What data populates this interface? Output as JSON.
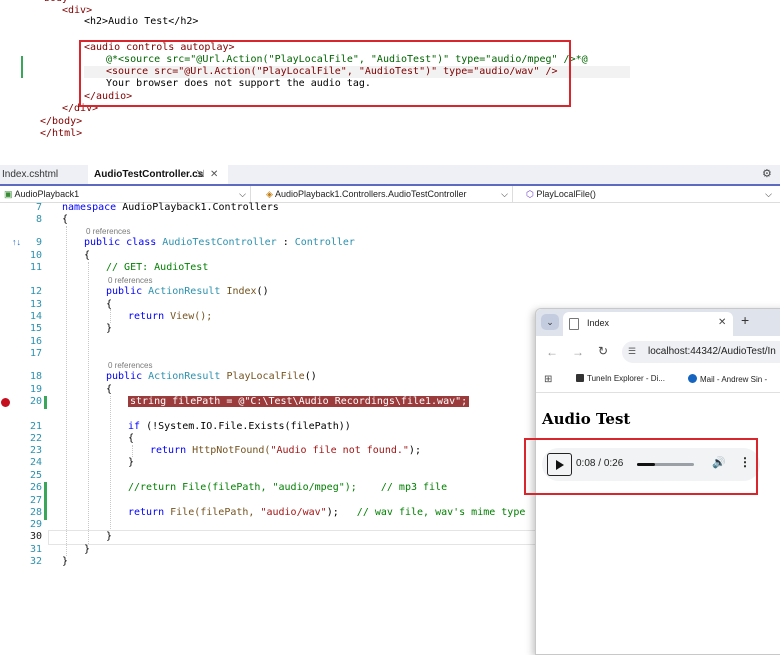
{
  "html_editor": {
    "lines": {
      "body_open": "body",
      "div_open": "<div>",
      "h2_line": "<h2>Audio Test</h2>",
      "audio_open": "<audio controls autoplay>",
      "source_mp3": "@*<source src=\"@Url.Action(\"PlayLocalFile\", \"AudioTest\")\" type=\"audio/mpeg\" />*@",
      "source_wav": "<source src=\"@Url.Action(\"PlayLocalFile\", \"AudioTest\")\" type=\"audio/wav\" />",
      "fallback": "Your browser does not support the audio tag.",
      "audio_close": "</audio>",
      "div_close": "</div>",
      "body_close": "</body>",
      "html_close": "</html>"
    }
  },
  "tabs": [
    {
      "label": "Index.cshtml",
      "active": false
    },
    {
      "label": "AudioTestController.cs",
      "active": true
    }
  ],
  "navbar": {
    "project": "AudioPlayback1",
    "class": "AudioPlayback1.Controllers.AudioTestController",
    "member": "PlayLocalFile()"
  },
  "cs_editor": {
    "line_numbers": [
      "7",
      "8",
      "9",
      "10",
      "11",
      "12",
      "13",
      "14",
      "15",
      "16",
      "17",
      "18",
      "19",
      "20",
      "21",
      "22",
      "23",
      "24",
      "25",
      "26",
      "27",
      "28",
      "29",
      "30",
      "31",
      "32"
    ],
    "refs_label": "0 references",
    "code": {
      "ns_kw": "namespace",
      "ns_name": " AudioPlayback1.Controllers",
      "brace_open": "{",
      "brace_close": "}",
      "pub": "public",
      "cls_kw": "class",
      "cls_name": "AudioTestController",
      "colon": " : ",
      "base": "Controller",
      "cmt_get": "// GET: AudioTest",
      "ar_type": "ActionResult",
      "index_m": "Index",
      "parens": "()",
      "ret": "return",
      "view_call": " View();",
      "plf": "PlayLocalFile",
      "breakpoint_stmt": "string filePath = @\"C:\\Test\\Audio Recordings\\file1.wav\";",
      "if_kw": "if",
      "if_rest": " (!System.IO.File.Exists(filePath))",
      "nf_call": "HttpNotFound(",
      "nf_str": "\"Audio file not found.\"",
      "nf_end": ");",
      "cmt_mp3": "//return File(filePath, \"audio/mpeg\");    // mp3 file",
      "ret_file": " File(filePath, ",
      "wav_str": "\"audio/wav\"",
      "ret_file_end": ");",
      "cmt_wav": "   // wav file, wav's mime type"
    }
  },
  "browser": {
    "tab_title": "Index",
    "address": "localhost:44342/AudioTest/In",
    "bookmarks": [
      "TuneIn Explorer - Di...",
      "Mail - Andrew Sin -"
    ],
    "heading": "Audio Test",
    "player": {
      "current": "0:08",
      "separator": " / ",
      "duration": "0:26",
      "progress": 0.31
    }
  },
  "colors": {
    "highlight_box": "#d9262c",
    "breakpoint": "#c50f1f",
    "change_bar": "#3aa65a"
  }
}
